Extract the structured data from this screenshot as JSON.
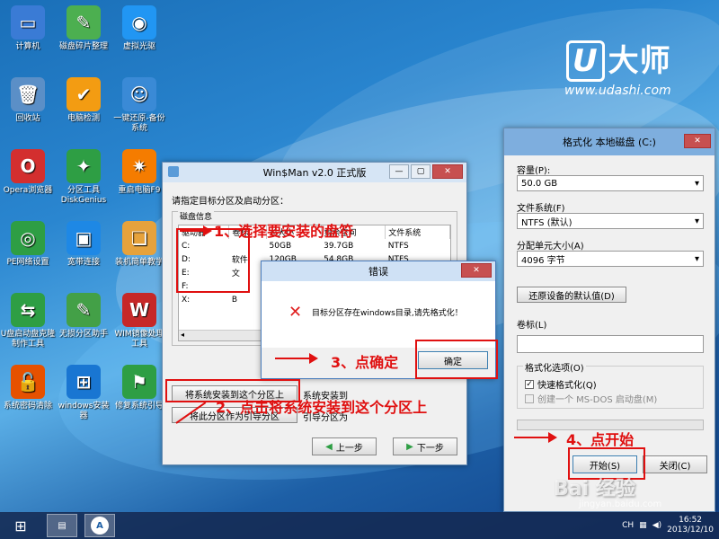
{
  "desktop": {
    "icons": [
      {
        "label": "计算机",
        "glyph": "▭",
        "color": "#3a7bd5",
        "icon": "computer-icon"
      },
      {
        "label": "磁盘碎片整理",
        "glyph": "✎",
        "color": "#4caf50",
        "icon": "broom-icon"
      },
      {
        "label": "虚拟光驱",
        "glyph": "◉",
        "color": "#2196f3",
        "icon": "disc-icon"
      },
      {
        "label": "回收站",
        "glyph": "🗑",
        "color": "#5b8fc7",
        "icon": "recycle-bin-icon"
      },
      {
        "label": "电脑检测",
        "glyph": "✔",
        "color": "#f39c12",
        "icon": "shield-check-icon"
      },
      {
        "label": "一键还原-备份系统",
        "glyph": "☺",
        "color": "#3a8ad6",
        "icon": "ghost-icon"
      },
      {
        "label": "Opera浏览器",
        "glyph": "O",
        "color": "#d32f2f",
        "icon": "opera-icon"
      },
      {
        "label": "分区工具DiskGenius",
        "glyph": "✦",
        "color": "#2e9e44",
        "icon": "wrench-icon"
      },
      {
        "label": "重启电脑F9",
        "glyph": "✷",
        "color": "#f57c00",
        "icon": "restart-icon"
      },
      {
        "label": "PE网络设置",
        "glyph": "◎",
        "color": "#2e9e44",
        "icon": "network-icon"
      },
      {
        "label": "宽带连接",
        "glyph": "▣",
        "color": "#1e88e5",
        "icon": "broadband-icon"
      },
      {
        "label": "装机简单教学",
        "glyph": "❏",
        "color": "#e6a23c",
        "icon": "book-icon"
      },
      {
        "label": "U盘启动盘克隆制作工具",
        "glyph": "⇆",
        "color": "#2e9e44",
        "icon": "usb-clone-icon"
      },
      {
        "label": "无损分区助手",
        "glyph": "✎",
        "color": "#43a047",
        "icon": "partition-assistant-icon"
      },
      {
        "label": "WIM镜像处理工具",
        "glyph": "W",
        "color": "#c62828",
        "icon": "wim-icon"
      },
      {
        "label": "系统密码清除",
        "glyph": "🔓",
        "color": "#e65100",
        "icon": "unlock-icon"
      },
      {
        "label": "windows安装器",
        "glyph": "⊞",
        "color": "#1976d2",
        "icon": "windows-icon"
      },
      {
        "label": "修复系统引导",
        "glyph": "⚑",
        "color": "#2e9e44",
        "icon": "repair-boot-icon"
      }
    ]
  },
  "logo": {
    "mark_u": "U",
    "mark_text": "大师",
    "url": "www.udashi.com"
  },
  "winsman": {
    "title": "Win$Man v2.0 正式版",
    "prompt": "请指定目标分区及启动分区：",
    "group_label": "磁盘信息",
    "columns": [
      "驱动器",
      "卷标",
      "总大小",
      "剩余空间",
      "文件系统"
    ],
    "rows": [
      {
        "drive": "C:",
        "label": "",
        "total": "50GB",
        "free": "39.7GB",
        "fs": "NTFS"
      },
      {
        "drive": "D:",
        "label": "软件",
        "total": "120GB",
        "free": "54.8GB",
        "fs": "NTFS"
      },
      {
        "drive": "E:",
        "label": "文",
        "total": "",
        "free": "",
        "fs": ""
      },
      {
        "drive": "F:",
        "label": "",
        "total": "",
        "free": "",
        "fs": ""
      },
      {
        "drive": "X:",
        "label": "B",
        "total": "",
        "free": "",
        "fs": ""
      }
    ],
    "install_btn": "将系统安装到这个分区上",
    "boot_btn": "将此分区作为引导分区",
    "install_status": "系统安装到",
    "boot_status": "引导分区为",
    "prev_btn": "上一步",
    "next_btn": "下一步"
  },
  "error_dialog": {
    "title": "错误",
    "message": "目标分区存在windows目录,请先格式化！",
    "ok_btn": "确定"
  },
  "format_dialog": {
    "title": "格式化 本地磁盘 (C:)",
    "capacity_label": "容量(P):",
    "capacity_value": "50.0 GB",
    "fs_label": "文件系统(F)",
    "fs_value": "NTFS (默认)",
    "alloc_label": "分配单元大小(A)",
    "alloc_value": "4096 字节",
    "restore_btn": "还原设备的默认值(D)",
    "volume_label": "卷标(L)",
    "volume_value": "",
    "options_label": "格式化选项(O)",
    "quick_format": "快速格式化(Q)",
    "msdos_boot": "创建一个 MS-DOS 启动盘(M)",
    "start_btn": "开始(S)",
    "close_btn": "关闭(C)"
  },
  "annotations": {
    "step1": "1、选择要安装的盘符",
    "step2": "2、点击将系统安装到这个分区上",
    "step3": "3、点确定",
    "step4": "4、点开始"
  },
  "taskbar": {
    "tray_lang": "CH",
    "time": "16:52",
    "date": "2013/12/10"
  },
  "watermark": {
    "text": "Bai 经验",
    "url": "jingyan.baidu.com"
  }
}
